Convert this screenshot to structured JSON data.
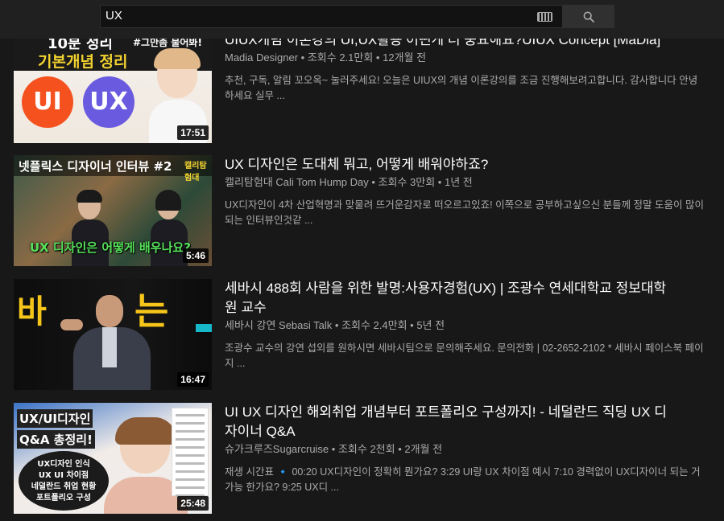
{
  "search": {
    "query": "UX"
  },
  "videos": [
    {
      "title": "UIUX개념 이론강의 UI,UX활용 어떤게 더 중요해요?UIUX Concept [MaDia]",
      "channel": "Madia Designer",
      "meta": "조회수 2.1만회 • 12개월 전",
      "description": "추천, 구독, 알림 꼬오옥~ 눌러주세요! 오늘은 UIUX의 개념 이론강의를 조금 진행해보려고합니다. 감사합니다 안녕하세요 실무 ...",
      "duration": "17:51",
      "thumb": {
        "line1": "10분 정리",
        "line2": "기본개념 정리",
        "tag": "#그만좀 물어봐!",
        "circle1": "UI",
        "circle2": "UX"
      }
    },
    {
      "title": "UX 디자인은 도대체 뭐고, 어떻게 배워야하죠?",
      "channel": "캘리탐험대 Cali Tom Hump Day",
      "meta": "조회수 3만회 • 1년 전",
      "description": "UX디자인이 4차 산업혁명과 맞물려 뜨거운감자로 떠오르고있죠! 이쪽으로 공부하고싶으신 분들께 정말 도움이 많이되는 인터뷰인것같 ...",
      "duration": "5:46",
      "thumb": {
        "top": "넷플릭스 디자이너 인터뷰 #2",
        "logo": "캘리탐험대",
        "bottom": "UX 디자인은 어떻게 배우나요?"
      }
    },
    {
      "title": "세바시 488회 사람을 위한 발명:사용자경험(UX) | 조광수 연세대학교 정보대학원 교수",
      "channel": "세바시 강연 Sebasi Talk",
      "meta": "조회수 2.4만회 • 5년 전",
      "description": "조광수 교수의 강연 섭외를 원하시면 세바시팀으로 문의해주세요. 문의전화 | 02-2652-2102 * 세바시 페이스북 페이지 ...",
      "duration": "16:47",
      "thumb": {
        "neon1": "바",
        "neon2": "는"
      }
    },
    {
      "title": "UI UX 디자인 해외취업 개념부터 포트폴리오 구성까지! - 네덜란드 직딩 UX 디자이너 Q&A",
      "channel": "슈가크루즈Sugarcruise",
      "meta": "조회수 2천회 • 2개월 전",
      "description": "재생 시간표 🔹 00:20 UX디자인이 정확히 뭔가요? 3:29 UI랑 UX 차이점 예시 7:10 경력없이 UX디자이너 되는 거 가능 한가요? 9:25 UX디 ...",
      "duration": "25:48",
      "thumb": {
        "label1": "UX/UI디자인",
        "label2": "Q&A 총정리!",
        "bubble": "UX디자인 인식\nUX UI 차이점\n네덜란드 취업 현황\n포트폴리오 구성"
      }
    }
  ]
}
